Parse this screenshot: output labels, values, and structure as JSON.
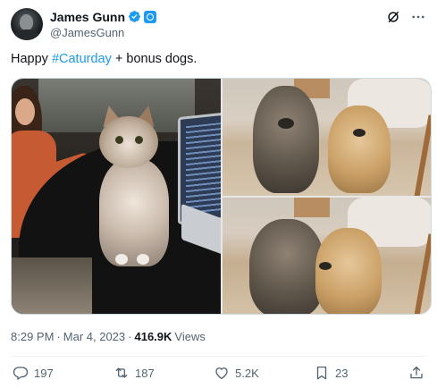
{
  "author": {
    "display_name": "James Gunn",
    "handle": "@JamesGunn",
    "verified_icon": "verified-badge-icon",
    "affiliation_icon": "affiliation-badge-icon"
  },
  "header_actions": {
    "grok_icon": "grok-icon",
    "more_icon": "more-options-icon"
  },
  "tweet": {
    "text_before": "Happy ",
    "hashtag": "#Caturday",
    "text_after": " + bonus dogs."
  },
  "media": {
    "photo_count": 3,
    "photos": [
      "cat-on-table-photo",
      "two-dogs-photo",
      "two-dogs-cuddling-photo"
    ]
  },
  "meta": {
    "time": "8:29 PM",
    "separator": "·",
    "date": "Mar 4, 2023",
    "views_count": "416.9K",
    "views_label": "Views"
  },
  "actions": {
    "reply_count": "197",
    "retweet_count": "187",
    "like_count": "5.2K",
    "bookmark_count": "23"
  },
  "colors": {
    "text": "#0f1419",
    "secondary": "#536471",
    "accent": "#1d9bf0",
    "divider": "#eff3f4"
  }
}
